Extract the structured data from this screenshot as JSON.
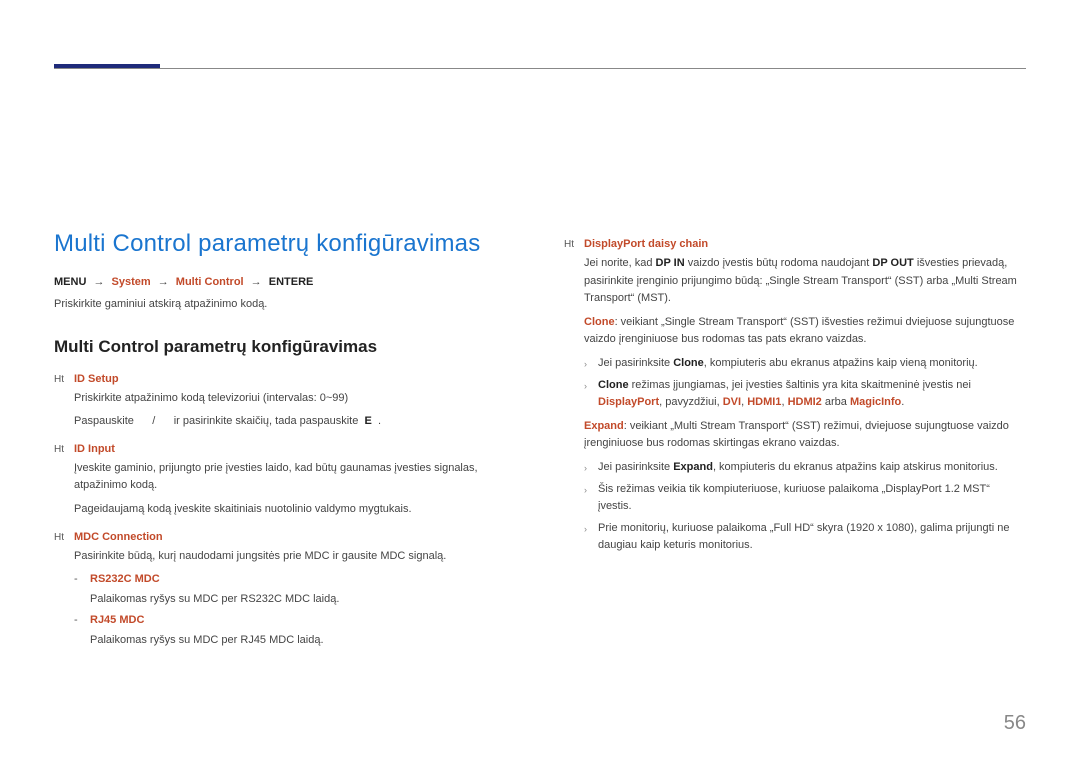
{
  "pageNumber": "56",
  "left": {
    "heading1": "Multi Control parametrų konfigūravimas",
    "breadcrumb": {
      "menu": "MENU",
      "system": "System",
      "multiControl": "Multi Control",
      "enter": "ENTER",
      "enterSymbol": "E"
    },
    "desc": "Priskirkite gaminiui atskirą atpažinimo kodą.",
    "heading2": "Multi Control parametrų konfigūravimas",
    "items": {
      "idSetup": {
        "title": "ID Setup",
        "line1": "Priskirkite atpažinimo kodą televizoriui (intervalas: 0~99)",
        "line2a": "Paspauskite",
        "line2b": "/",
        "line2c": "ir pasirinkite skaičių, tada paspauskite",
        "line2d": "E",
        "line2e": "."
      },
      "idInput": {
        "title": "ID Input",
        "line1": "Įveskite gaminio, prijungto prie įvesties laido, kad būtų gaunamas įvesties signalas, atpažinimo kodą.",
        "line2": "Pageidaujamą kodą įveskite skaitiniais nuotolinio valdymo mygtukais."
      },
      "mdc": {
        "title": "MDC Connection",
        "line1": "Pasirinkite būdą, kurį naudodami jungsitės prie MDC ir gausite MDC signalą.",
        "rs232c": {
          "title": "RS232C MDC",
          "text": "Palaikomas ryšys su MDC per RS232C MDC laidą."
        },
        "rj45": {
          "title": "RJ45 MDC",
          "text": "Palaikomas ryšys su MDC per RJ45 MDC laidą."
        }
      }
    }
  },
  "right": {
    "dpDaisy": {
      "title": "DisplayPort daisy chain",
      "p1a": "Jei norite, kad ",
      "p1b": "DP IN",
      "p1c": " vaizdo įvestis būtų rodoma naudojant ",
      "p1d": "DP OUT",
      "p1e": " išvesties prievadą, pasirinkite įrenginio prijungimo būdą: „Single Stream Transport“ (SST) arba „Multi Stream Transport“ (MST).",
      "clone": {
        "label": "Clone",
        "text": ": veikiant „Single Stream Transport“ (SST) išvesties režimui dviejuose sujungtuose vaizdo įrenginiuose bus rodomas tas pats ekrano vaizdas.",
        "b1a": "Jei pasirinksite ",
        "b1b": "Clone",
        "b1c": ", kompiuteris abu ekranus atpažins kaip vieną monitorių.",
        "b2a": "Clone",
        "b2b": " režimas įjungiamas, jei įvesties šaltinis yra kita skaitmeninė įvestis nei ",
        "b2c": "DisplayPort",
        "b2d": ", pavyzdžiui, ",
        "b2e": "DVI",
        "b2f": ", ",
        "b2g": "HDMI1",
        "b2h": ", ",
        "b2i": "HDMI2",
        "b2j": " arba ",
        "b2k": "MagicInfo",
        "b2l": "."
      },
      "expand": {
        "label": "Expand",
        "text": ": veikiant „Multi Stream Transport“ (SST) režimui, dviejuose sujungtuose vaizdo įrenginiuose bus rodomas skirtingas ekrano vaizdas.",
        "b1a": "Jei pasirinksite ",
        "b1b": "Expand",
        "b1c": ", kompiuteris du ekranus atpažins kaip atskirus monitorius.",
        "b2": "Šis režimas veikia tik kompiuteriuose, kuriuose palaikoma „DisplayPort 1.2 MST“ įvestis.",
        "b3": "Prie monitorių, kuriuose palaikoma „Full HD“ skyra (1920 x 1080), galima prijungti ne daugiau kaip keturis monitorius."
      }
    }
  }
}
